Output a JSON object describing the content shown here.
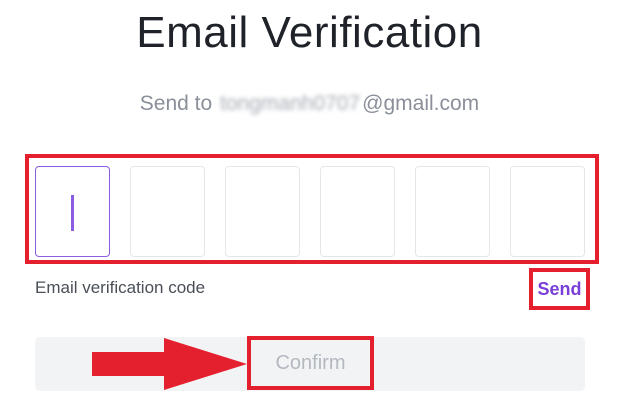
{
  "page": {
    "title": "Email Verification",
    "send_to_prefix": "Send to",
    "send_to_masked": "tongmanh0707",
    "send_to_domain": "@gmail.com"
  },
  "code_input": {
    "digits": [
      "",
      "",
      "",
      "",
      "",
      ""
    ],
    "label": "Email verification code",
    "send_label": "Send"
  },
  "actions": {
    "confirm_label": "Confirm"
  },
  "colors": {
    "accent": "#7a3fd9",
    "annotation_red": "#e5202e",
    "disabled_text": "#b4b8bf",
    "confirm_bg": "#f2f3f5"
  }
}
